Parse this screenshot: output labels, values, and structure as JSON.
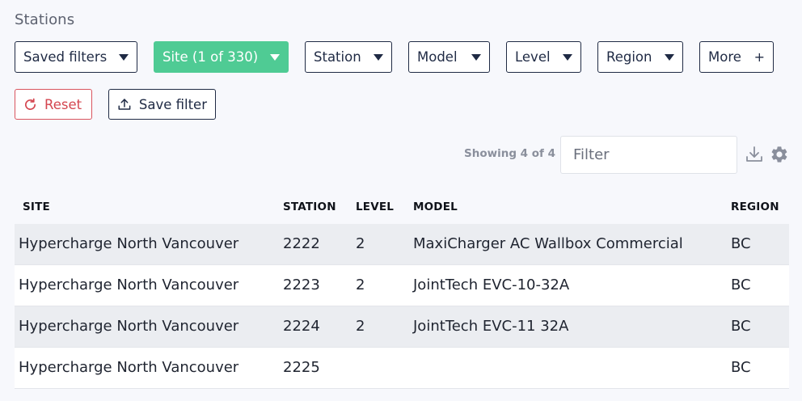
{
  "page": {
    "title": "Stations"
  },
  "filters": [
    {
      "label": "Saved filters",
      "active": false
    },
    {
      "label": "Site (1 of 330)",
      "active": true
    },
    {
      "label": "Station",
      "active": false
    },
    {
      "label": "Model",
      "active": false
    },
    {
      "label": "Level",
      "active": false
    },
    {
      "label": "Region",
      "active": false
    }
  ],
  "more": {
    "label": "More",
    "symbol": "+"
  },
  "actions": {
    "reset_label": "Reset",
    "save_label": "Save filter"
  },
  "toolbar": {
    "showing_text": "Showing 4 of 4",
    "filter_placeholder": "Filter",
    "filter_value": ""
  },
  "table": {
    "columns": [
      "SITE",
      "STATION",
      "LEVEL",
      "MODEL",
      "REGION"
    ],
    "rows": [
      {
        "site": "Hypercharge North Vancouver",
        "station": "2222",
        "level": "2",
        "model": "MaxiCharger AC Wallbox Commercial",
        "region": "BC"
      },
      {
        "site": "Hypercharge North Vancouver",
        "station": "2223",
        "level": "2",
        "model": "JointTech EVC-10-32A",
        "region": "BC"
      },
      {
        "site": "Hypercharge North Vancouver",
        "station": "2224",
        "level": "2",
        "model": "JointTech EVC-11 32A",
        "region": "BC"
      },
      {
        "site": "Hypercharge North Vancouver",
        "station": "2225",
        "level": "",
        "model": "",
        "region": "BC"
      }
    ]
  },
  "colors": {
    "accent": "#4fcb94",
    "reset": "#d44650",
    "border": "#1f2a44",
    "row_alt": "#ebedf1",
    "background": "#f7f8fc"
  },
  "icons": {
    "reset": "refresh-icon",
    "save": "upload-icon",
    "download": "download-icon",
    "settings": "gear-icon",
    "caret": "caret-down-icon"
  }
}
